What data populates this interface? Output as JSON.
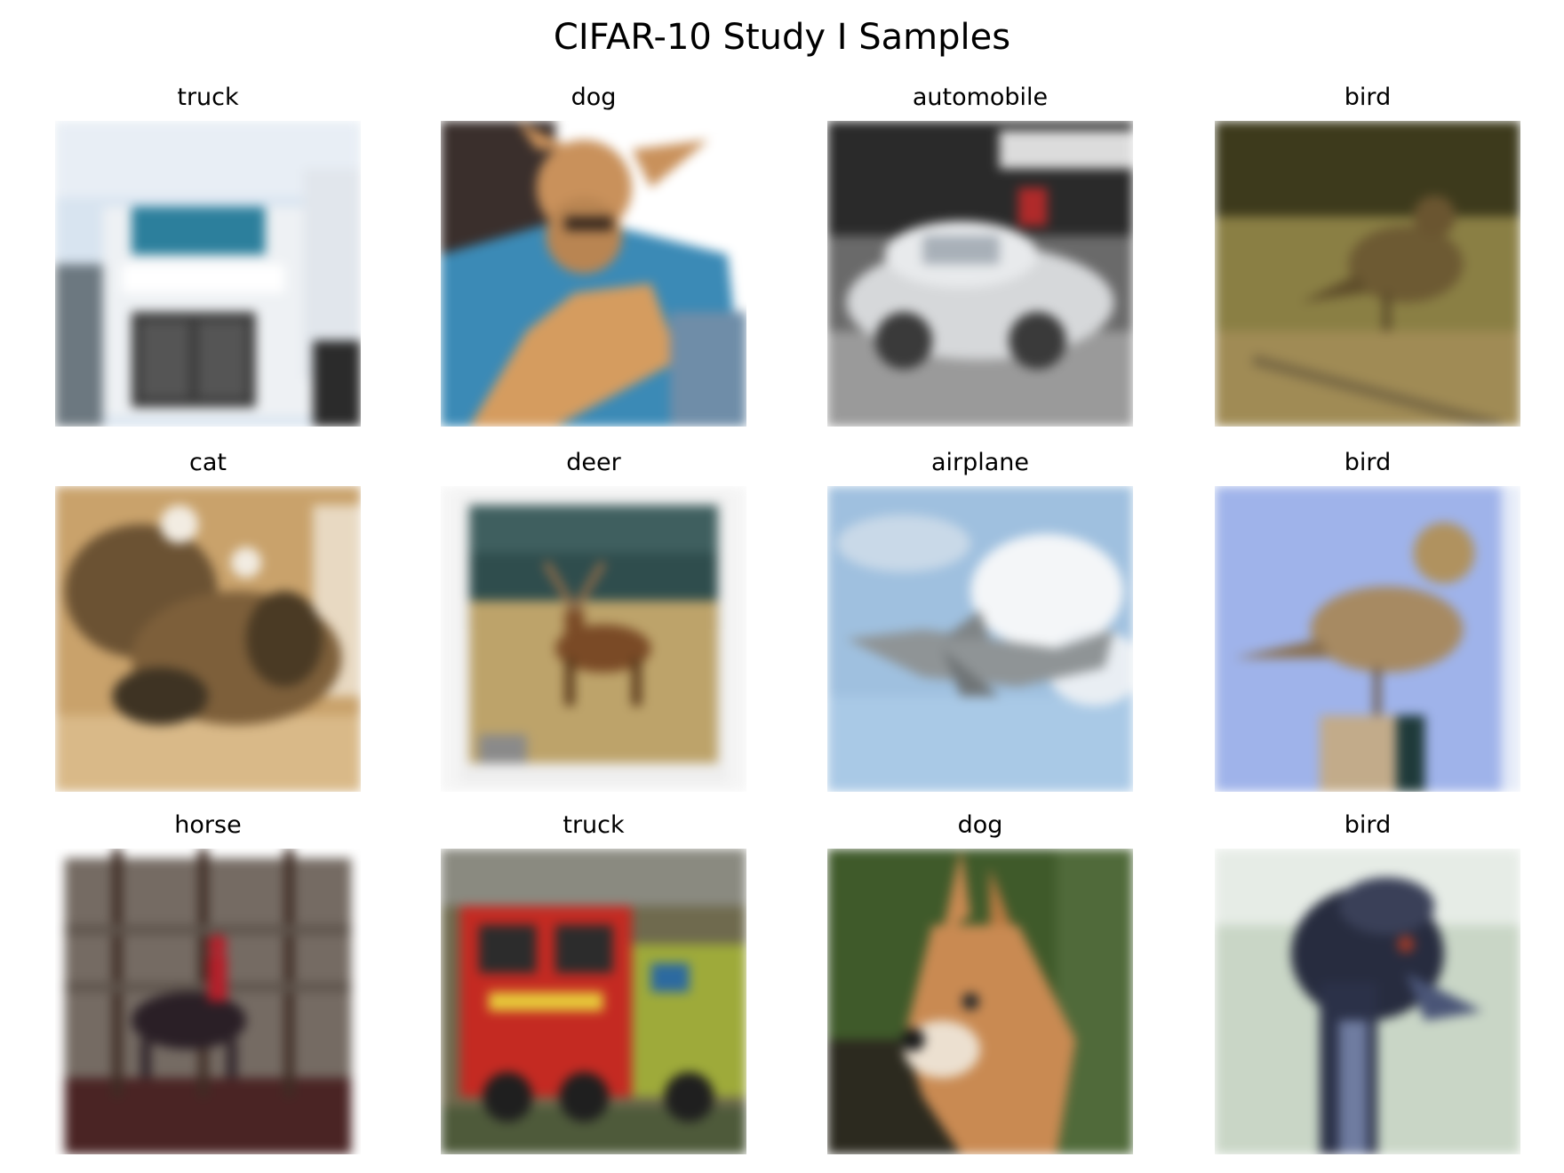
{
  "figure": {
    "title": "CIFAR-10 Study I Samples"
  },
  "samples": [
    {
      "label": "truck"
    },
    {
      "label": "dog"
    },
    {
      "label": "automobile"
    },
    {
      "label": "bird"
    },
    {
      "label": "cat"
    },
    {
      "label": "deer"
    },
    {
      "label": "airplane"
    },
    {
      "label": "bird"
    },
    {
      "label": "horse"
    },
    {
      "label": "truck"
    },
    {
      "label": "dog"
    },
    {
      "label": "bird"
    }
  ]
}
